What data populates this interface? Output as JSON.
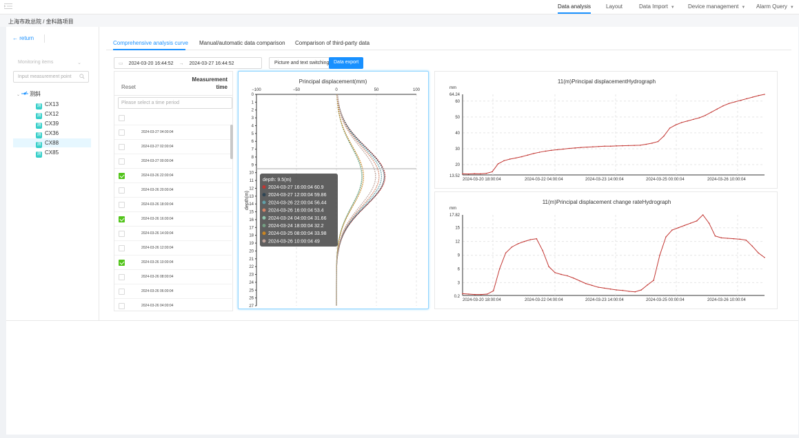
{
  "nav": {
    "items": [
      {
        "label": "Data analysis",
        "active": true,
        "dropdown": false
      },
      {
        "label": "Layout",
        "active": false,
        "dropdown": false
      },
      {
        "label": "Data Import",
        "active": false,
        "dropdown": true
      },
      {
        "label": "Device management",
        "active": false,
        "dropdown": true
      },
      {
        "label": "Alarm Query",
        "active": false,
        "dropdown": true
      }
    ]
  },
  "breadcrumb": "上海市政总院 /  金科路项目",
  "sidebar": {
    "return_label": "return",
    "monitoring_placeholder": "Monitoring items",
    "search_placeholder": "Input measurement point",
    "tree_root": "测斜",
    "tree_items": [
      "CX13",
      "CX12",
      "CX39",
      "CX36",
      "CX88",
      "CX85"
    ],
    "tag_letter": "测",
    "selected_item": "CX88"
  },
  "tabs": [
    {
      "label": "Comprehensive analysis curve",
      "active": true
    },
    {
      "label": "Manual/automatic data comparison",
      "active": false
    },
    {
      "label": "Comparison of third-party data",
      "active": false
    }
  ],
  "toolbar": {
    "start_date": "2024-03-20 16:44:52",
    "end_date": "2024-03-27 16:44:52",
    "arrow": "→",
    "switch_label": "Picture and text switching",
    "export_label": "Data export"
  },
  "table": {
    "reset_label": "Reset",
    "header_line1": "Measurement",
    "header_line2": "time",
    "time_placeholder": "Please select a time period",
    "rows": [
      {
        "time": "",
        "checked": false
      },
      {
        "time": "2024-03-27 04:00:04",
        "checked": false
      },
      {
        "time": "2024-03-27 02:00:04",
        "checked": false
      },
      {
        "time": "2024-03-27 00:00:04",
        "checked": false
      },
      {
        "time": "2024-03-26 22:00:04",
        "checked": true
      },
      {
        "time": "2024-03-26 20:00:04",
        "checked": false
      },
      {
        "time": "2024-03-26 18:00:04",
        "checked": false
      },
      {
        "time": "2024-03-26 16:00:04",
        "checked": true
      },
      {
        "time": "2024-03-26 14:00:04",
        "checked": false
      },
      {
        "time": "2024-03-26 12:00:04",
        "checked": false
      },
      {
        "time": "2024-03-26 10:00:04",
        "checked": true
      },
      {
        "time": "2024-03-26 08:00:04",
        "checked": false
      },
      {
        "time": "2024-03-26 06:00:04",
        "checked": false
      },
      {
        "time": "2024-03-26 04:00:04",
        "checked": false
      },
      {
        "time": "2024-03-26 02:00:04",
        "checked": false
      }
    ]
  },
  "colors": {
    "accent": "#1890ff",
    "check": "#52c41a",
    "line_red": "#c23531",
    "tag": "#36cfc9"
  },
  "chart_data": [
    {
      "type": "line",
      "title": "Principal displacement(mm)",
      "ylabel": "depth(m)",
      "xlim": [
        -100,
        100
      ],
      "x_ticks": [
        -100,
        -50,
        0,
        50,
        100
      ],
      "ylim": [
        0,
        27
      ],
      "y_inverted": true,
      "depths": [
        0,
        1,
        2,
        3,
        4,
        5,
        6,
        7,
        8,
        9,
        10,
        11,
        12,
        13,
        14,
        15,
        16,
        17,
        18,
        19,
        20,
        21,
        22,
        23,
        24,
        25,
        26,
        27
      ],
      "series": [
        {
          "name": "2024-03-27 16:00:04",
          "value": 60.9,
          "color": "#c23531"
        },
        {
          "name": "2024-03-27 12:00:04",
          "value": 59.86,
          "color": "#2f4554"
        },
        {
          "name": "2024-03-26 22:00:04",
          "value": 56.44,
          "color": "#61a0a8"
        },
        {
          "name": "2024-03-26 16:00:04",
          "value": 53.4,
          "color": "#d48265"
        },
        {
          "name": "2024-03-24 04:00:04",
          "value": 31.66,
          "color": "#91c7ae"
        },
        {
          "name": "2024-03-24 18:00:04",
          "value": 32.2,
          "color": "#749f83"
        },
        {
          "name": "2024-03-25 08:00:04",
          "value": 33.98,
          "color": "#ca8622"
        },
        {
          "name": "2024-03-26 10:00:04",
          "value": 49,
          "color": "#bda29a"
        }
      ],
      "tooltip": {
        "depth_label": "depth:  9.5(m)",
        "depth": 9.5
      }
    },
    {
      "type": "line",
      "title": "11(m)Principal displacementHydrograph",
      "ylabel": "mm",
      "ylim": [
        13.52,
        64.24
      ],
      "y_ticks": [
        20,
        30,
        40,
        50,
        60
      ],
      "y_edge_labels": [
        "13.52",
        "64.24"
      ],
      "x_labels": [
        "2024-03-20 18:00:04",
        "2024-03-22 04:00:04",
        "2024-03-23 14:00:04",
        "2024-03-25 00:00:04",
        "2024-03-26 10:00:04"
      ],
      "values": [
        14.2,
        14.1,
        14.3,
        14.2,
        14.5,
        15.5,
        20.5,
        22.5,
        23.5,
        24.2,
        25,
        26,
        27,
        27.8,
        28.5,
        29,
        29.4,
        29.8,
        30.2,
        30.5,
        30.8,
        31,
        31.2,
        31.4,
        31.6,
        31.6,
        31.8,
        31.9,
        32,
        32.1,
        32.2,
        32.8,
        33.5,
        34.5,
        38,
        43,
        45,
        46.5,
        47.5,
        48.5,
        49.5,
        51,
        53,
        55,
        57,
        58.5,
        59.5,
        60.5,
        61.5,
        62.5,
        63.5,
        64.24
      ]
    },
    {
      "type": "line",
      "title": "11(m)Principal displacement change rateHydrograph",
      "ylabel": "mm",
      "ylim": [
        0.2,
        17.82
      ],
      "y_ticks": [
        3,
        6,
        9,
        12,
        15
      ],
      "y_edge_labels": [
        "0.2",
        "17.82"
      ],
      "x_labels": [
        "2024-03-20 18:00:04",
        "2024-03-22 04:00:04",
        "2024-03-23 14:00:04",
        "2024-03-25 00:00:04",
        "2024-03-26 10:00:04"
      ],
      "values": [
        0.6,
        0.5,
        0.4,
        0.4,
        0.5,
        1.2,
        6,
        9.5,
        10.8,
        11.5,
        12,
        12.4,
        12.6,
        10,
        6.5,
        5.2,
        4.8,
        4.5,
        4,
        3.4,
        2.8,
        2.4,
        2,
        1.8,
        1.6,
        1.4,
        1.3,
        1.1,
        1,
        1.4,
        2.5,
        3.5,
        9,
        13,
        14.5,
        15,
        15.5,
        16,
        16.5,
        17.82,
        16,
        13.2,
        12.8,
        12.7,
        12.6,
        12.5,
        12.3,
        11,
        9.5,
        8.5
      ]
    }
  ]
}
